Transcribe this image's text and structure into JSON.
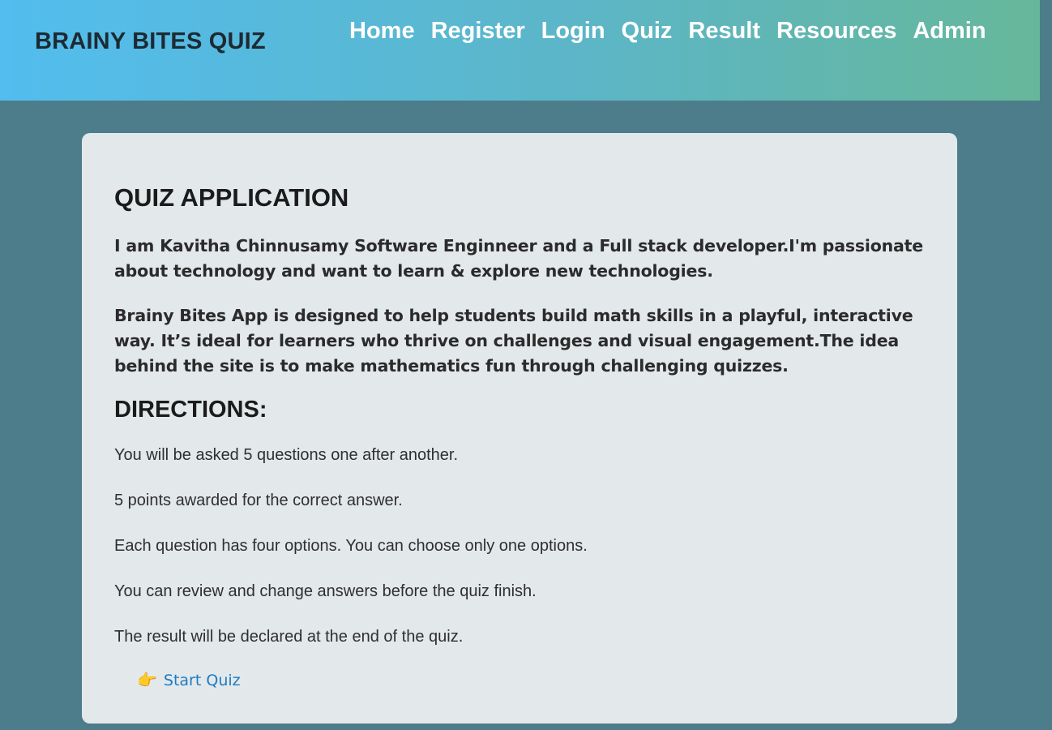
{
  "navbar": {
    "brand": "BRAINY BITES QUIZ",
    "links": [
      "Home",
      "Register",
      "Login",
      "Quiz",
      "Result",
      "Resources",
      "Admin"
    ]
  },
  "card": {
    "title": "QUIZ APPLICATION",
    "intro": [
      "I am Kavitha Chinnusamy Software Enginneer and a Full stack developer.I'm passionate about technology and want to learn & explore new technologies.",
      "Brainy Bites App is designed to help students build math skills in a playful, interactive way. It’s ideal for learners who thrive on challenges and visual engagement.The idea behind the site is to make mathematics fun through challenging quizzes."
    ],
    "directions_title": "DIRECTIONS:",
    "directions": [
      "You will be asked 5 questions one after another.",
      "5 points awarded for the correct answer.",
      "Each question has four options. You can choose only one options.",
      "You can review and change answers before the quiz finish.",
      "The result will be declared at the end of the quiz."
    ],
    "start": {
      "icon": "👉",
      "icon_name": "pointing-hand-icon",
      "label": "Start Quiz"
    }
  },
  "colors": {
    "page_background": "#4d7c8a",
    "navbar_gradient_start": "#52bdee",
    "navbar_gradient_end": "#66b79a",
    "card_background": "#e3e8eb",
    "link": "#1f7bc0"
  }
}
